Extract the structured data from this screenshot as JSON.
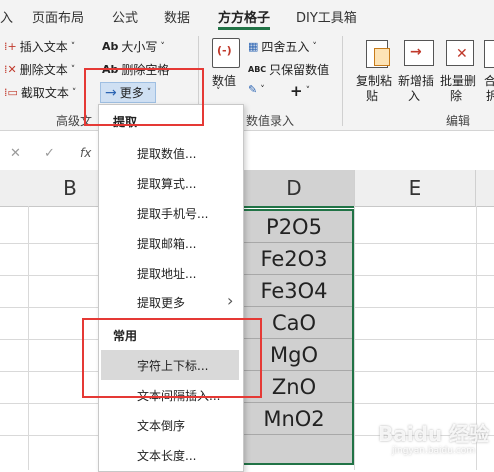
{
  "tabs": [
    "入",
    "页面布局",
    "公式",
    "数据",
    "方方格子",
    "DIY工具箱"
  ],
  "active_tab": "方方格子",
  "ribbon": {
    "insert_text": "插入文本",
    "delete_text": "删除文本",
    "cut_text": "截取文本",
    "case": "大小写",
    "delete_space": "删除空格",
    "more": "更多",
    "group_advanced_text": "高级文",
    "numeric": "数值",
    "round": "四舍五入",
    "keep_numeric": "只保留数值",
    "group_numeric_entry": "数值录入",
    "copy_paste": [
      "复制粘",
      "贴"
    ],
    "new_insert": [
      "新增插",
      "入"
    ],
    "batch_delete": [
      "批量删",
      "除"
    ],
    "merge_partial": [
      "合",
      "拆"
    ],
    "group_edit": "编辑",
    "dropdown_arrow": "˅",
    "plus": "+",
    "abc_label": "Ab",
    "abc2_label": "ABC"
  },
  "formula_bar": {
    "x": "✕",
    "check": "✓",
    "fx": "fx"
  },
  "columns": [
    "B",
    "D",
    "E"
  ],
  "cells_D": [
    "P2O5",
    "Fe2O3",
    "Fe3O4",
    "CaO",
    "MgO",
    "ZnO",
    "MnO2"
  ],
  "menu": {
    "header_extract": "提取",
    "extract_items": [
      "提取数值...",
      "提取算式...",
      "提取手机号...",
      "提取邮箱...",
      "提取地址...",
      "提取更多"
    ],
    "header_common": "常用",
    "common_items": [
      "字符上下标...",
      "文本间隔插入...",
      "文本倒序",
      "文本长度..."
    ],
    "submenu_arrow": "›"
  },
  "watermark": "Baidu 经验",
  "watermark_sub": "jingyan.baidu.com",
  "colors": {
    "annotation_red": "#e53935",
    "selection_gray": "#d0d0d0",
    "accent_green": "#217346"
  }
}
